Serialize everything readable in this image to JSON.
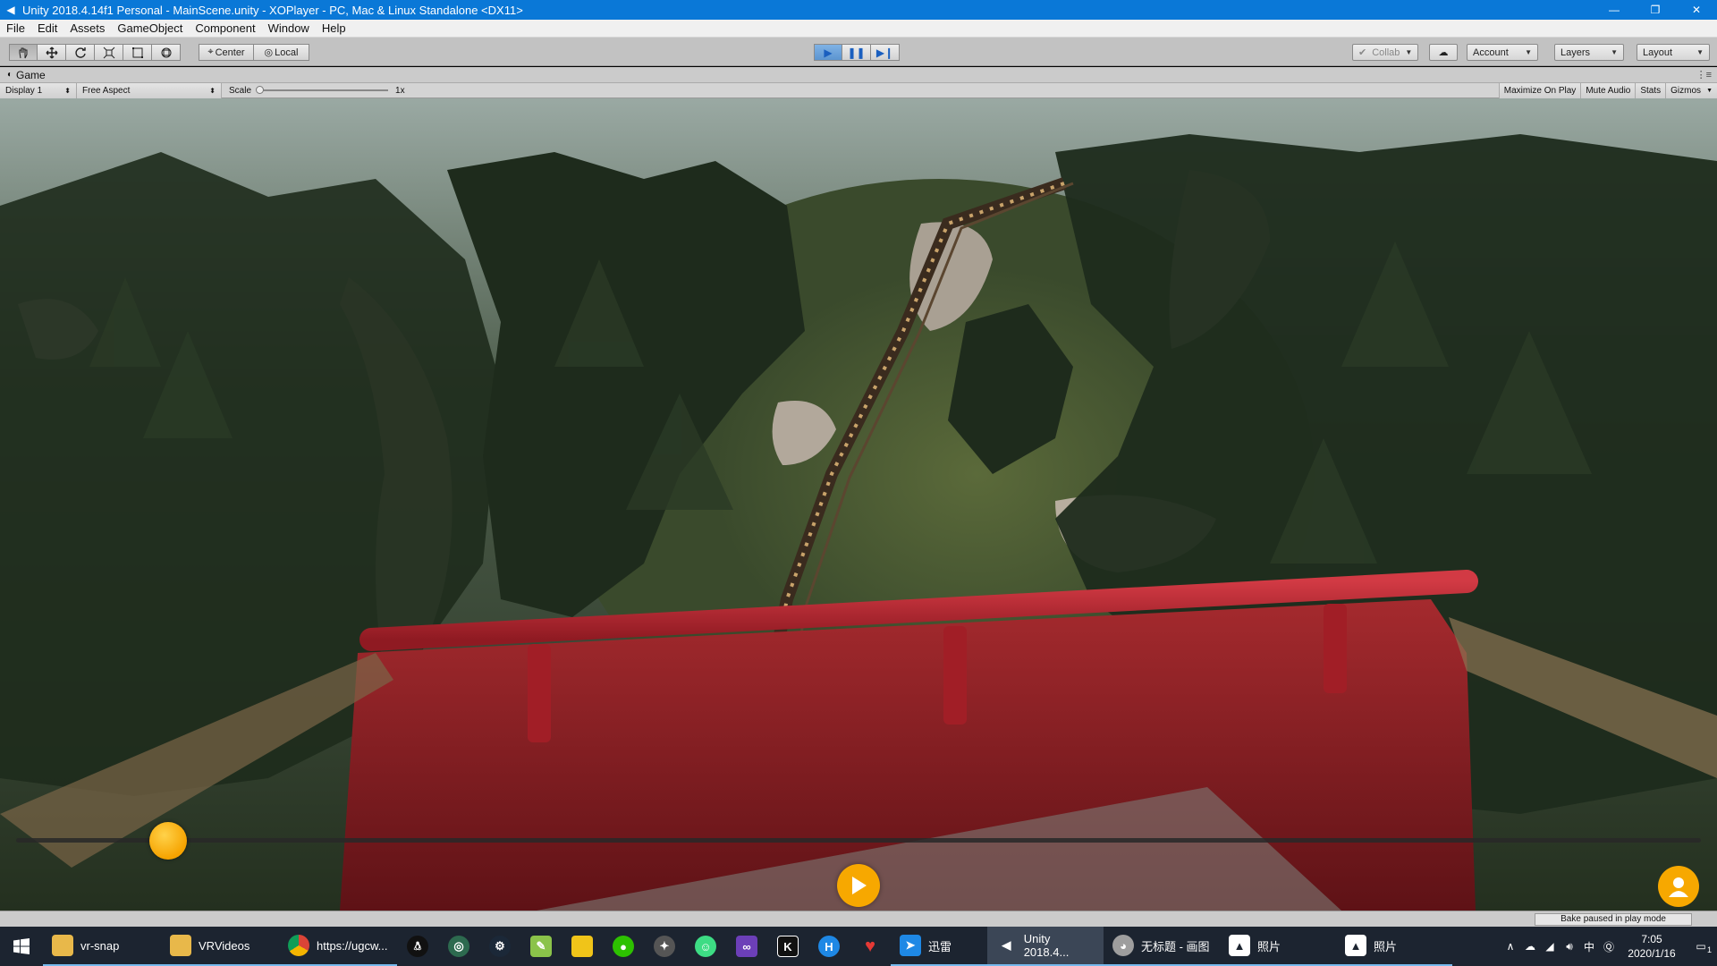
{
  "window": {
    "title": "Unity 2018.4.14f1 Personal - MainScene.unity - XOPlayer - PC, Mac & Linux Standalone <DX11>"
  },
  "menu": {
    "items": [
      "File",
      "Edit",
      "Assets",
      "GameObject",
      "Component",
      "Window",
      "Help"
    ]
  },
  "toolbar": {
    "pivot_label": "Center",
    "space_label": "Local",
    "collab_label": "Collab",
    "account_label": "Account",
    "layers_label": "Layers",
    "layout_label": "Layout"
  },
  "game": {
    "tab_label": "Game",
    "display_label": "Display 1",
    "aspect_label": "Free Aspect",
    "scale_label": "Scale",
    "scale_value": "1x",
    "maximize_label": "Maximize On Play",
    "mute_label": "Mute Audio",
    "stats_label": "Stats",
    "gizmos_label": "Gizmos"
  },
  "player": {
    "progress": 0.09
  },
  "status": {
    "bake_text": "Bake paused in play mode"
  },
  "taskbar": {
    "tasks": [
      {
        "label": "vr-snap",
        "icon": "folder-icon"
      },
      {
        "label": "VRVideos",
        "icon": "folder-icon"
      },
      {
        "label": "https://ugcw...",
        "icon": "chrome-icon"
      }
    ],
    "tasks2": [
      {
        "label": "迅雷",
        "icon": "xunlei-icon"
      },
      {
        "label": "Unity 2018.4...",
        "icon": "unity-icon"
      },
      {
        "label": "无标题 - 画图",
        "icon": "paint-icon"
      },
      {
        "label": "照片",
        "icon": "photos-icon"
      },
      {
        "label": "照片",
        "icon": "photos-icon"
      }
    ],
    "ime": "中",
    "time": "7:05",
    "date": "2020/1/16",
    "notifications": "1"
  },
  "colors": {
    "accent": "#0a78d7",
    "player_orange": "#f7a800",
    "rail_red": "#b3232a"
  }
}
